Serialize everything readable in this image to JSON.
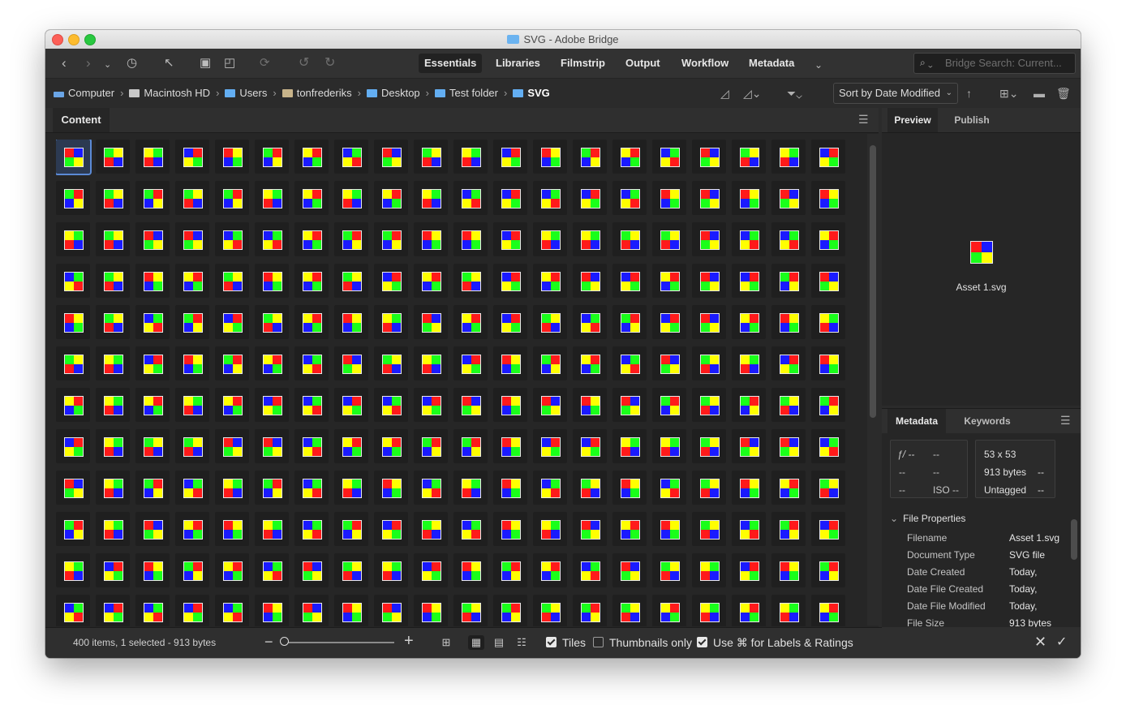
{
  "window": {
    "title": "SVG - Adobe Bridge"
  },
  "toolbar": {
    "workspaces": [
      "Essentials",
      "Libraries",
      "Filmstrip",
      "Output",
      "Workflow",
      "Metadata"
    ],
    "active_workspace": "Essentials",
    "search_placeholder": "Bridge Search: Current..."
  },
  "breadcrumb": [
    {
      "label": "Computer",
      "icon": "computer-icon"
    },
    {
      "label": "Macintosh HD",
      "icon": "disk-icon"
    },
    {
      "label": "Users",
      "icon": "folder-icon"
    },
    {
      "label": "tonfrederiks",
      "icon": "home-icon"
    },
    {
      "label": "Desktop",
      "icon": "folder-icon"
    },
    {
      "label": "Test folder",
      "icon": "folder-icon"
    },
    {
      "label": "SVG",
      "icon": "folder-icon"
    }
  ],
  "sort": {
    "label": "Sort by Date Modified"
  },
  "content": {
    "tab_label": "Content",
    "selected_index": 0
  },
  "status": {
    "summary": "400 items, 1 selected - 913 bytes",
    "tiles_label": "Tiles",
    "tiles_checked": true,
    "thumbnails_only_label": "Thumbnails only",
    "thumbnails_only_checked": false,
    "labels_ratings_label": "Use ⌘ for Labels & Ratings",
    "labels_ratings_checked": true
  },
  "preview": {
    "tabs": [
      "Preview",
      "Publish"
    ],
    "active_tab": "Preview",
    "filename": "Asset 1.svg"
  },
  "metadata": {
    "tabs": [
      "Metadata",
      "Keywords"
    ],
    "active_tab": "Metadata",
    "camera": {
      "fstop": "ƒ/ --",
      "shutter": "--",
      "r2a": "--",
      "r2b": "--",
      "r3a": "--",
      "iso": "ISO --"
    },
    "file_summary": {
      "dimensions": "53 x 53",
      "size": "913 bytes",
      "size_extra": "--",
      "tag": "Untagged",
      "tag_extra": "--"
    },
    "file_properties_heading": "File Properties",
    "file_properties": [
      {
        "label": "Filename",
        "value": "Asset 1.svg"
      },
      {
        "label": "Document Type",
        "value": "SVG file"
      },
      {
        "label": "Date Created",
        "value": "Today,"
      },
      {
        "label": "Date File Created",
        "value": "Today,"
      },
      {
        "label": "Date File Modified",
        "value": "Today,"
      },
      {
        "label": "File Size",
        "value": "913 bytes"
      }
    ]
  },
  "colors": {
    "red": "#ff1a1a",
    "yellow": "#ffff00",
    "green": "#1aff1a",
    "blue": "#1a1aff",
    "selection": "#5b8ad6",
    "chrome": "#2b2b2b"
  }
}
